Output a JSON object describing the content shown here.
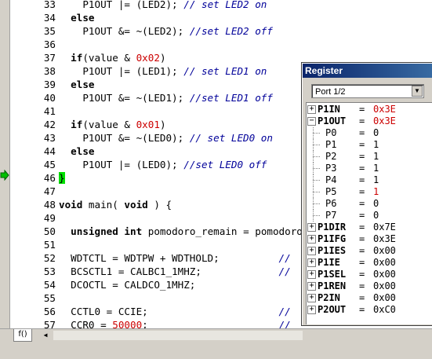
{
  "editor": {
    "lines": [
      {
        "n": "33",
        "html": "    P1OUT |= (LED2); <span class='cmt'>// set LED2 on</span>"
      },
      {
        "n": "34",
        "html": "  <span class='kw'>else</span>"
      },
      {
        "n": "35",
        "html": "    P1OUT &= ~(LED2); <span class='cmt'>//set LED2 off</span>"
      },
      {
        "n": "36",
        "html": ""
      },
      {
        "n": "37",
        "html": "  <span class='kw'>if</span>(value & <span class='num'>0x02</span>)"
      },
      {
        "n": "38",
        "html": "    P1OUT |= (LED1); <span class='cmt'>// set LED1 on</span>"
      },
      {
        "n": "39",
        "html": "  <span class='kw'>else</span>"
      },
      {
        "n": "40",
        "html": "    P1OUT &= ~(LED1); <span class='cmt'>//set LED1 off</span>"
      },
      {
        "n": "41",
        "html": ""
      },
      {
        "n": "42",
        "html": "  <span class='kw'>if</span>(value & <span class='num'>0x01</span>)"
      },
      {
        "n": "43",
        "html": "    P1OUT &= ~(LED0); <span class='cmt'>// set LED0 on</span>"
      },
      {
        "n": "44",
        "html": "  <span class='kw'>else</span>"
      },
      {
        "n": "45",
        "html": "    P1OUT |= (LED0); <span class='cmt'>//set LED0 off</span>"
      },
      {
        "n": "46",
        "html": "<span class='cur'>}</span>"
      },
      {
        "n": "47",
        "html": ""
      },
      {
        "n": "48",
        "html": "<span class='kw'>void</span> main( <span class='kw'>void</span> ) {"
      },
      {
        "n": "49",
        "html": ""
      },
      {
        "n": "50",
        "html": "  <span class='kw'>unsigned int</span> pomodoro_remain = pomodoro"
      },
      {
        "n": "51",
        "html": ""
      },
      {
        "n": "52",
        "html": "  WDTCTL = WDTPW + WDTHOLD;          <span class='cmt'>//</span>"
      },
      {
        "n": "53",
        "html": "  BCSCTL1 = CALBC1_1MHZ;             <span class='cmt'>//</span>"
      },
      {
        "n": "54",
        "html": "  DCOCTL = CALDCO_1MHZ;"
      },
      {
        "n": "55",
        "html": ""
      },
      {
        "n": "56",
        "html": "  CCTL0 = CCIE;                      <span class='cmt'>//</span>"
      },
      {
        "n": "57",
        "html": "  CCR0 = <span class='num'>50000</span>;                      <span class='cmt'>//</span>"
      }
    ],
    "current_line_marker": "46",
    "bottom_tab": "f()"
  },
  "register_window": {
    "title": "Register",
    "selected_group": "Port 1/2",
    "rows": [
      {
        "name": "P1IN",
        "value": "0x3E",
        "expander": "+",
        "level": 0,
        "changed": true
      },
      {
        "name": "P1OUT",
        "value": "0x3E",
        "expander": "−",
        "level": 0,
        "changed": true
      },
      {
        "name": "P0",
        "value": "0",
        "expander": "",
        "level": 1,
        "changed": false
      },
      {
        "name": "P1",
        "value": "1",
        "expander": "",
        "level": 1,
        "changed": false
      },
      {
        "name": "P2",
        "value": "1",
        "expander": "",
        "level": 1,
        "changed": false
      },
      {
        "name": "P3",
        "value": "1",
        "expander": "",
        "level": 1,
        "changed": false
      },
      {
        "name": "P4",
        "value": "1",
        "expander": "",
        "level": 1,
        "changed": false
      },
      {
        "name": "P5",
        "value": "1",
        "expander": "",
        "level": 1,
        "changed": true
      },
      {
        "name": "P6",
        "value": "0",
        "expander": "",
        "level": 1,
        "changed": false
      },
      {
        "name": "P7",
        "value": "0",
        "expander": "",
        "level": 1,
        "changed": false
      },
      {
        "name": "P1DIR",
        "value": "0x7E",
        "expander": "+",
        "level": 0,
        "changed": false
      },
      {
        "name": "P1IFG",
        "value": "0x3E",
        "expander": "+",
        "level": 0,
        "changed": false
      },
      {
        "name": "P1IES",
        "value": "0x00",
        "expander": "+",
        "level": 0,
        "changed": false
      },
      {
        "name": "P1IE",
        "value": "0x00",
        "expander": "+",
        "level": 0,
        "changed": false
      },
      {
        "name": "P1SEL",
        "value": "0x00",
        "expander": "+",
        "level": 0,
        "changed": false
      },
      {
        "name": "P1REN",
        "value": "0x00",
        "expander": "+",
        "level": 0,
        "changed": false
      },
      {
        "name": "P2IN",
        "value": "0x00",
        "expander": "+",
        "level": 0,
        "changed": false
      },
      {
        "name": "P2OUT",
        "value": "0xC0",
        "expander": "+",
        "level": 0,
        "changed": false
      }
    ]
  },
  "colors": {
    "changed_value": "#cc0000",
    "current_line_highlight": "#00e000",
    "comment": "#000099",
    "title_bar": "#0a246a"
  }
}
